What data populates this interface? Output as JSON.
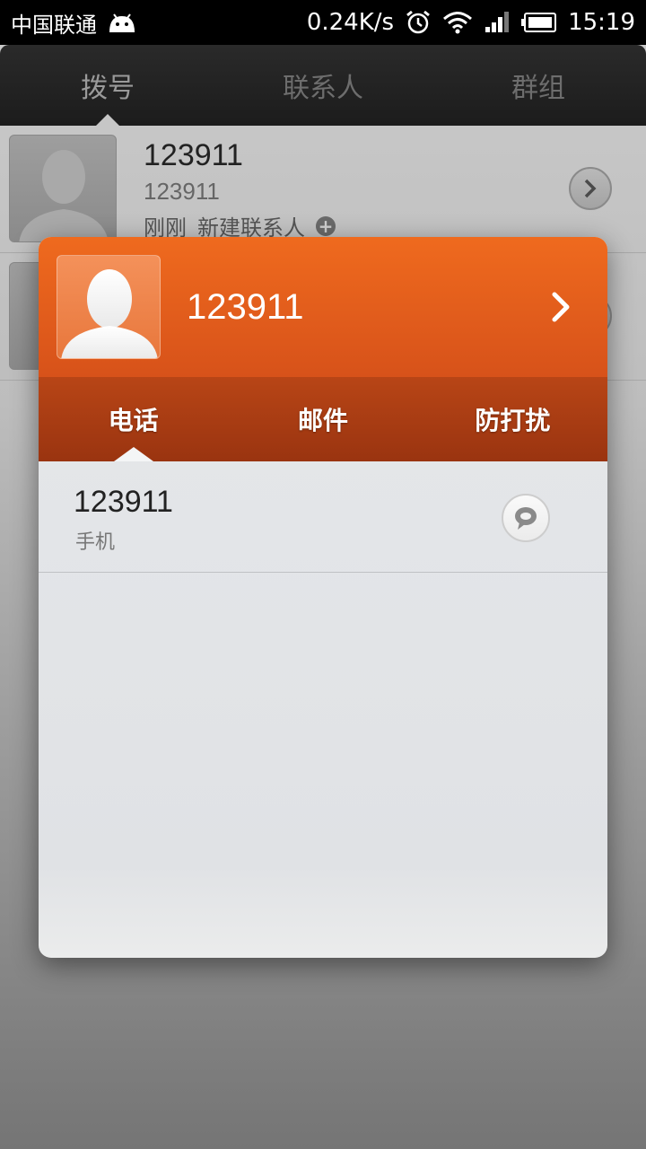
{
  "status_bar": {
    "carrier": "中国联通",
    "net_speed": "0.24K/s",
    "time": "15:19",
    "icons": [
      "android-icon",
      "alarm-icon",
      "wifi-icon",
      "signal-icon",
      "battery-icon"
    ]
  },
  "app": {
    "tabs": [
      {
        "label": "拨号",
        "active": true
      },
      {
        "label": "联系人",
        "active": false
      },
      {
        "label": "群组",
        "active": false
      }
    ],
    "list": [
      {
        "name": "123911",
        "number": "123911",
        "time": "刚刚",
        "action": "新建联系人"
      }
    ]
  },
  "popup": {
    "name": "123911",
    "accent_color": "#e8621d",
    "tabs": [
      {
        "label": "电话",
        "active": true
      },
      {
        "label": "邮件",
        "active": false
      },
      {
        "label": "防打扰",
        "active": false
      }
    ],
    "phones": [
      {
        "number": "123911",
        "type": "手机"
      }
    ]
  }
}
